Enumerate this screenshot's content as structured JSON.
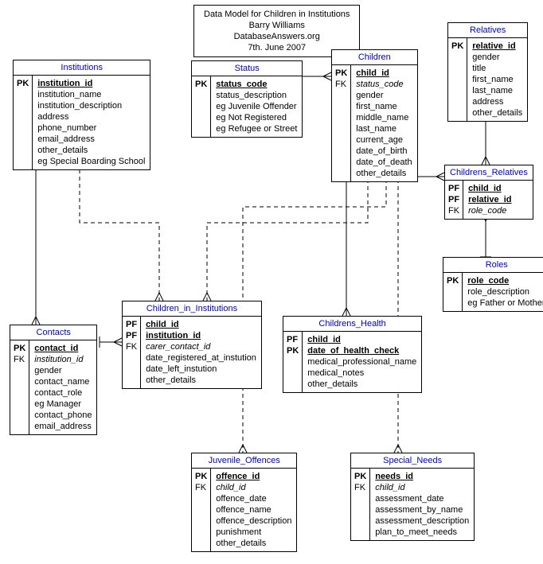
{
  "title": {
    "line1": "Data Model for Children in Institutions",
    "line2": "Barry Williams",
    "line3": "DatabaseAnswers.org",
    "line4": "7th. June 2007"
  },
  "entities": {
    "institutions": {
      "name": "Institutions",
      "keys": [
        "PK",
        "",
        "",
        "",
        "",
        "",
        "",
        ""
      ],
      "attrs": [
        "institution_id",
        "institution_name",
        "institution_description",
        "address",
        "phone_number",
        "email_address",
        "other_details",
        "eg Special Boarding School"
      ],
      "pk_rows": [
        0
      ]
    },
    "status": {
      "name": "Status",
      "keys": [
        "PK",
        "",
        "",
        "",
        ""
      ],
      "attrs": [
        "status_code",
        "status_description",
        "eg Juvenile Offender",
        "eg Not Registered",
        "eg Refugee or Street"
      ],
      "pk_rows": [
        0
      ]
    },
    "children": {
      "name": "Children",
      "keys": [
        "PK",
        "FK",
        "",
        "",
        "",
        "",
        "",
        "",
        "",
        ""
      ],
      "attrs": [
        "child_id",
        "status_code",
        "gender",
        "first_name",
        "middle_name",
        "last_name",
        "current_age",
        "date_of_birth",
        "date_of_death",
        "other_details"
      ],
      "pk_rows": [
        0
      ],
      "fk_rows": [
        1
      ]
    },
    "relatives": {
      "name": "Relatives",
      "keys": [
        "PK",
        "",
        "",
        "",
        "",
        "",
        ""
      ],
      "attrs": [
        "relative_id",
        "gender",
        "title",
        "first_name",
        "last_name",
        "address",
        "other_details"
      ],
      "pk_rows": [
        0
      ]
    },
    "childrens_relatives": {
      "name": "Childrens_Relatives",
      "keys": [
        "PF",
        "PF",
        "FK"
      ],
      "attrs": [
        "child_id",
        "relative_id",
        "role_code"
      ],
      "pk_rows": [
        0,
        1
      ],
      "fk_rows": [
        2
      ]
    },
    "roles": {
      "name": "Roles",
      "keys": [
        "PK",
        "",
        ""
      ],
      "attrs": [
        "role_code",
        "role_description",
        "eg Father or Mother"
      ],
      "pk_rows": [
        0
      ]
    },
    "contacts": {
      "name": "Contacts",
      "keys": [
        "PK",
        "FK",
        "",
        "",
        "",
        "",
        "",
        ""
      ],
      "attrs": [
        "contact_id",
        "institution_id",
        "gender",
        "contact_name",
        "contact_role",
        "eg Manager",
        "contact_phone",
        "email_address"
      ],
      "pk_rows": [
        0
      ],
      "fk_rows": [
        1
      ]
    },
    "children_in_institutions": {
      "name": "Children_in_Institutions",
      "keys": [
        "PF",
        "PF",
        "FK",
        "",
        "",
        ""
      ],
      "attrs": [
        "child_id",
        "institution_id",
        "carer_contact_id",
        "date_registered_at_instution",
        "date_left_instution",
        "other_details"
      ],
      "pk_rows": [
        0,
        1
      ],
      "fk_rows": [
        2
      ]
    },
    "childrens_health": {
      "name": "Childrens_Health",
      "keys": [
        "PF",
        "PK",
        "",
        "",
        ""
      ],
      "attrs": [
        "child_id",
        "date_of_health_check",
        "medical_professional_name",
        "medical_notes",
        "other_details"
      ],
      "pk_rows": [
        0,
        1
      ]
    },
    "juvenile_offences": {
      "name": "Juvenile_Offences",
      "keys": [
        "PK",
        "FK",
        "",
        "",
        "",
        "",
        ""
      ],
      "attrs": [
        "offence_id",
        "child_id",
        "offence_date",
        "offence_name",
        "offence_description",
        "punishment",
        "other_details"
      ],
      "pk_rows": [
        0
      ],
      "fk_rows": [
        1
      ]
    },
    "special_needs": {
      "name": "Special_Needs",
      "keys": [
        "PK",
        "FK",
        "",
        "",
        "",
        ""
      ],
      "attrs": [
        "needs_id",
        "child_id",
        "assessment_date",
        "assessment_by_name",
        "assessment_description",
        "plan_to_meet_needs"
      ],
      "pk_rows": [
        0
      ],
      "fk_rows": [
        1
      ]
    }
  }
}
